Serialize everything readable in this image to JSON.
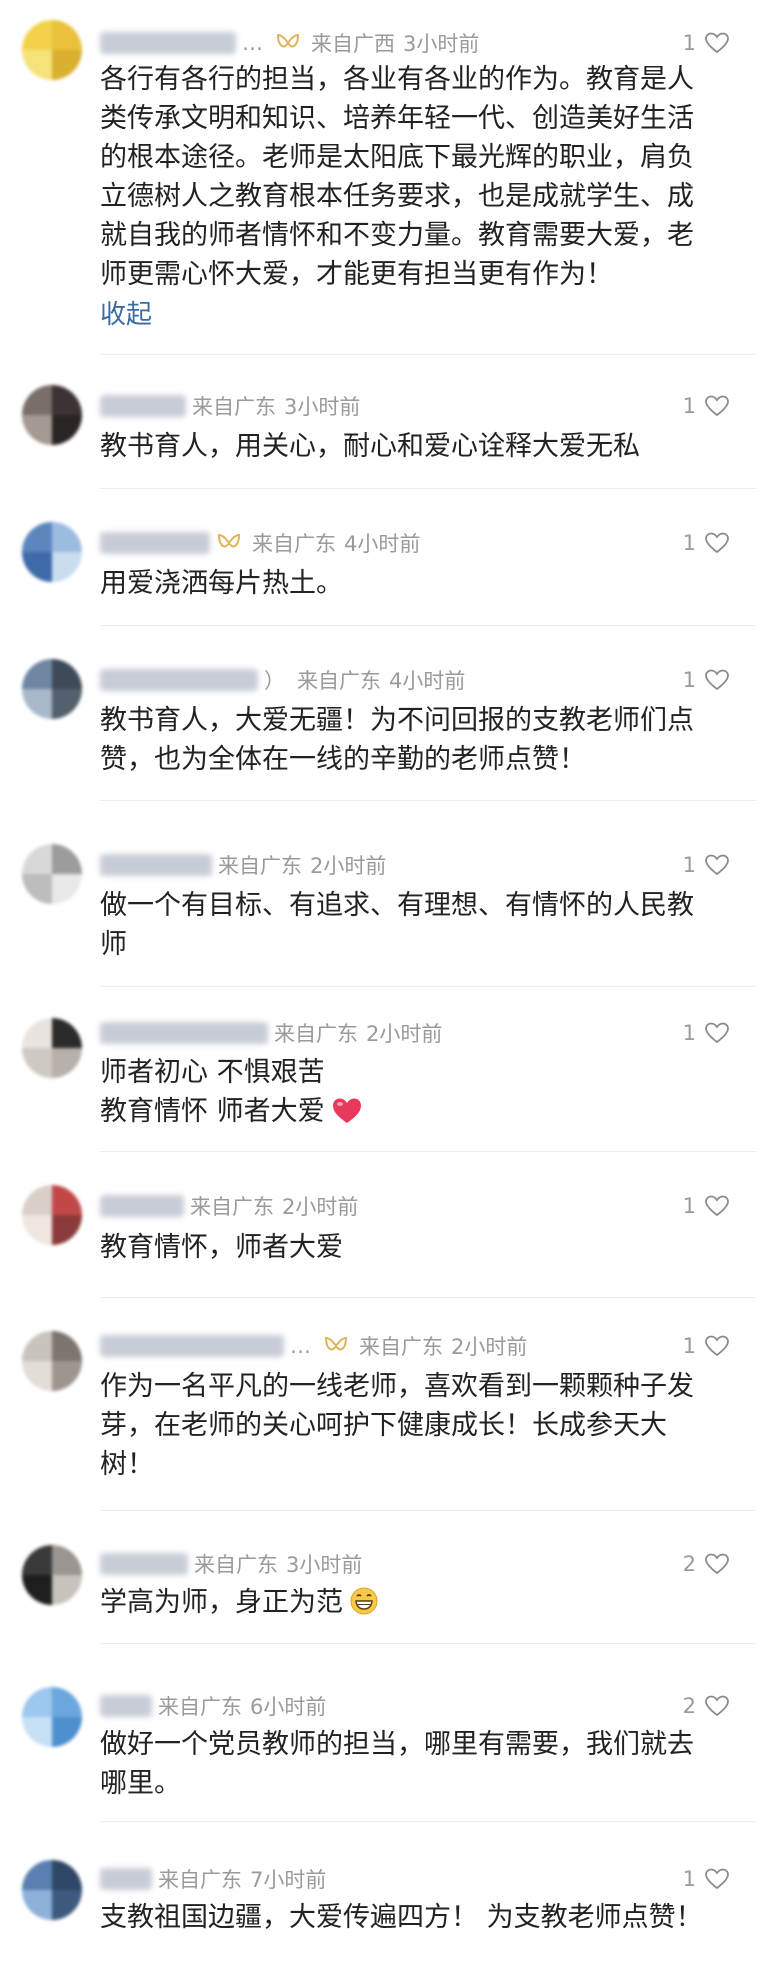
{
  "comments": [
    {
      "name_suffix": "…",
      "has_badge": true,
      "location": "来自广西",
      "time": "3小时前",
      "likes": "1",
      "lines": [
        "各行有各行的担当，各业有各业的作为。教育是人",
        "类传承文明和知识、培养年轻一代、创造美好生活",
        "的根本途径。老师是太阳底下最光辉的职业，肩负",
        "立德树人之教育根本任务要求，也是成就学生、成",
        "就自我的师者情怀和不变力量。教育需要大爱，老",
        "师更需心怀大爱，才能更有担当更有作为！"
      ],
      "collapse_label": "收起",
      "avatar_colors": [
        "#f2d24a",
        "#e9c13a",
        "#f6e27a",
        "#d9b030"
      ]
    },
    {
      "name_suffix": "",
      "has_badge": false,
      "location": "来自广东",
      "time": "3小时前",
      "likes": "1",
      "lines": [
        "教书育人，用关心，耐心和爱心诠释大爱无私"
      ],
      "avatar_colors": [
        "#7a6e6a",
        "#3b3432",
        "#a59a92",
        "#2a2524"
      ]
    },
    {
      "name_suffix": "",
      "has_badge": true,
      "location": "来自广东",
      "time": "4小时前",
      "likes": "1",
      "lines": [
        "用爱浇洒每片热土。"
      ],
      "avatar_colors": [
        "#5d86bf",
        "#9bbbe0",
        "#3f6aa8",
        "#c9dcf0"
      ]
    },
    {
      "name_suffix": "）",
      "has_badge": false,
      "location": "来自广东",
      "time": "4小时前",
      "likes": "1",
      "lines": [
        "教书育人，大爱无疆！为不问回报的支教老师们点",
        "赞，也为全体在一线的辛勤的老师点赞！"
      ],
      "avatar_colors": [
        "#6f86a3",
        "#3e4a59",
        "#a9b8c8",
        "#53606d"
      ]
    },
    {
      "name_suffix": "",
      "has_badge": false,
      "location": "来自广东",
      "time": "2小时前",
      "likes": "1",
      "lines": [
        "做一个有目标、有追求、有理想、有情怀的人民教",
        "师"
      ],
      "avatar_colors": [
        "#d8d8d8",
        "#9c9c9c",
        "#bcbcbc",
        "#e8e8e8"
      ]
    },
    {
      "name_suffix": "",
      "has_badge": false,
      "location": "来自广东",
      "time": "2小时前",
      "likes": "1",
      "lines": [
        "师者初心 不惧艰苦",
        "教育情怀 师者大爱"
      ],
      "emoji_line": 1,
      "emoji": "heart",
      "avatar_colors": [
        "#e9e4e0",
        "#2b2b2b",
        "#cfc9c4",
        "#b8b0aa"
      ]
    },
    {
      "name_suffix": "",
      "has_badge": false,
      "location": "来自广东",
      "time": "2小时前",
      "likes": "1",
      "lines": [
        "教育情怀，师者大爱"
      ],
      "avatar_colors": [
        "#d9cfc8",
        "#c24848",
        "#f0e6e0",
        "#8a3a3a"
      ]
    },
    {
      "name_suffix": "…",
      "has_badge": true,
      "location": "来自广东",
      "time": "2小时前",
      "likes": "1",
      "lines": [
        "作为一名平凡的一线老师，喜欢看到一颗颗种子发",
        "芽，在老师的关心呵护下健康成长！长成参天大",
        "树！"
      ],
      "avatar_colors": [
        "#c9c3bd",
        "#7d7570",
        "#e3ddd8",
        "#9e958f"
      ]
    },
    {
      "name_suffix": "",
      "has_badge": false,
      "location": "来自广东",
      "time": "3小时前",
      "likes": "2",
      "lines": [
        "学高为师，身正为范"
      ],
      "emoji_line": 0,
      "emoji": "grin",
      "avatar_colors": [
        "#3a3a3a",
        "#9a9590",
        "#1e1e1e",
        "#c8c2bc"
      ]
    },
    {
      "name_suffix": "",
      "has_badge": false,
      "location": "来自广东",
      "time": "6小时前",
      "likes": "2",
      "lines": [
        "做好一个党员教师的担当，哪里有需要，我们就去",
        "哪里。"
      ],
      "avatar_colors": [
        "#9cc7ee",
        "#6aa7de",
        "#c6e0f6",
        "#4e8fcf"
      ]
    },
    {
      "name_suffix": "",
      "has_badge": false,
      "location": "来自广东",
      "time": "7小时前",
      "likes": "1",
      "lines": [
        "支教祖国边疆，大爱传遍四方！ 为支教老师点赞！"
      ],
      "avatar_colors": [
        "#5a7fb0",
        "#2e4766",
        "#8fb0d8",
        "#3d5a80"
      ]
    }
  ]
}
